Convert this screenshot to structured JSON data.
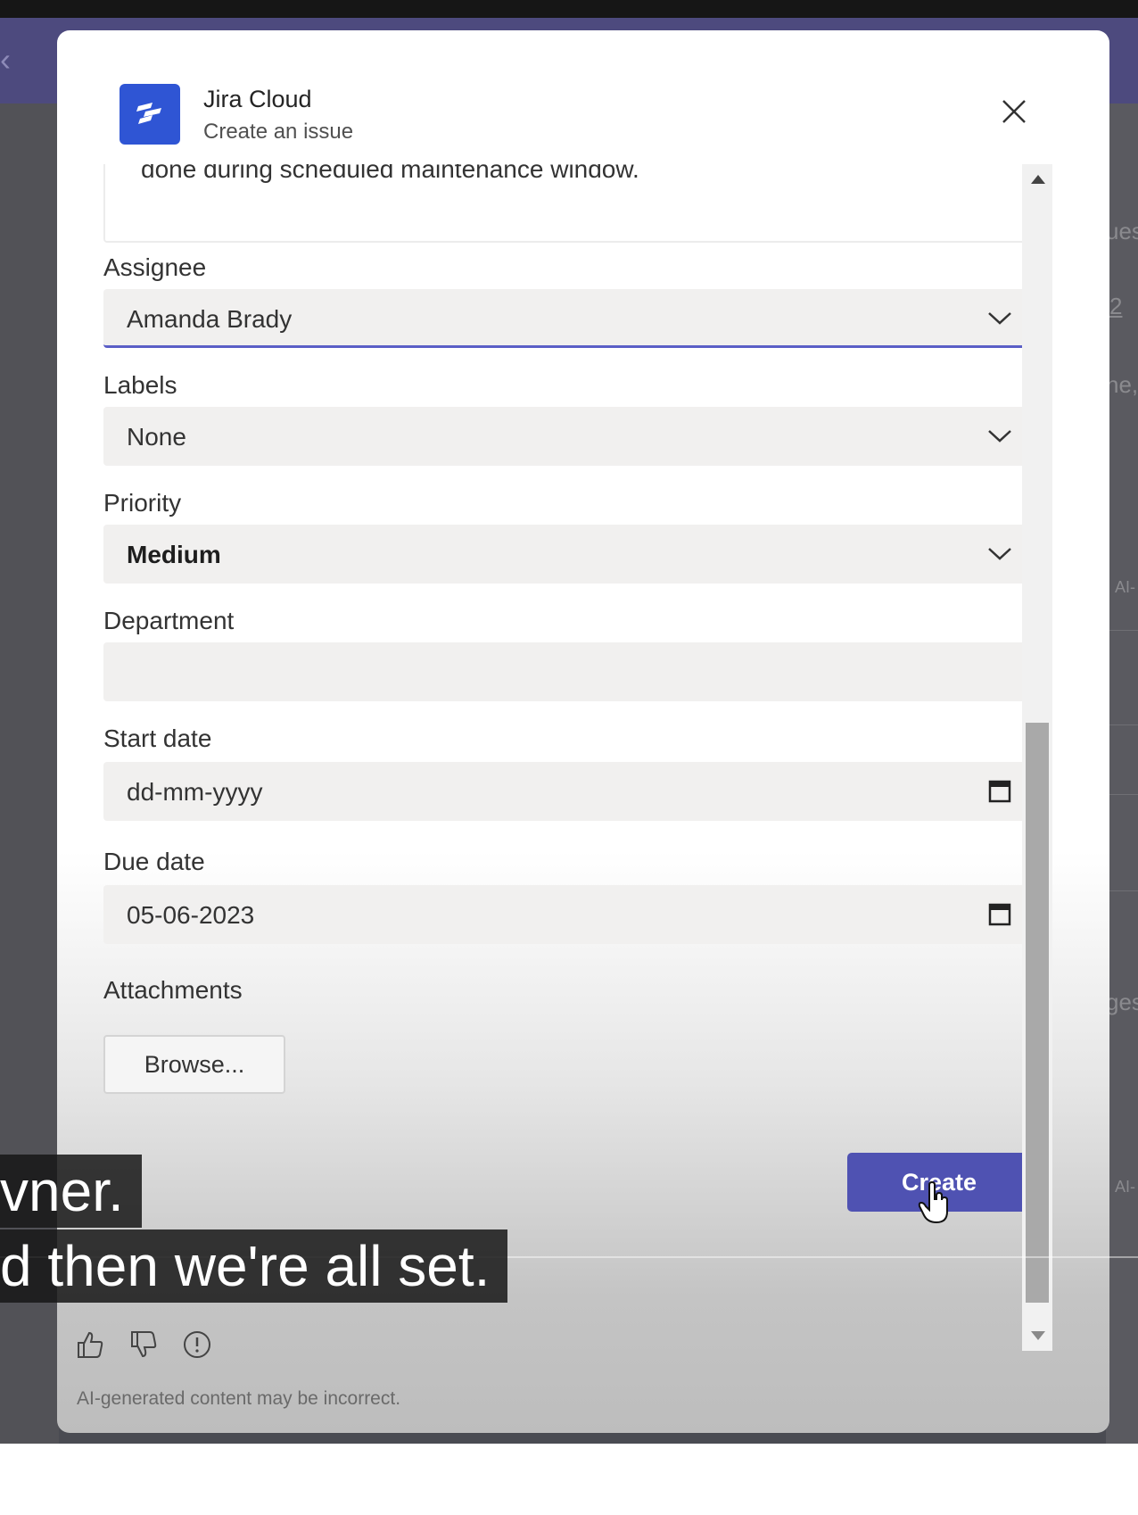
{
  "app": {
    "name": "Jira Cloud",
    "subtitle": "Create an issue",
    "icon": "jira-logo-icon",
    "accent_color": "#2f55d4"
  },
  "form": {
    "description_tail": "done during scheduled maintenance window.",
    "assignee": {
      "label": "Assignee",
      "value": "Amanda Brady"
    },
    "labels": {
      "label": "Labels",
      "value": "None"
    },
    "priority": {
      "label": "Priority",
      "value": "Medium"
    },
    "department": {
      "label": "Department",
      "value": ""
    },
    "start_date": {
      "label": "Start date",
      "value": "dd-mm-yyyy"
    },
    "due_date": {
      "label": "Due date",
      "value": "05-06-2023"
    },
    "attachments": {
      "label": "Attachments",
      "browse_label": "Browse..."
    }
  },
  "actions": {
    "create_label": "Create",
    "create_color": "#4f52b2"
  },
  "footer": {
    "disclaimer": "AI-generated content may be incorrect.",
    "icons": [
      "thumbs-up-icon",
      "thumbs-down-icon",
      "report-icon"
    ]
  },
  "captions": {
    "line1": "vner.",
    "line2": "d then we're all set."
  },
  "background": {
    "right_snippets": [
      "ues",
      "2",
      "ne,",
      "AI-",
      "ges",
      "AI-"
    ]
  }
}
